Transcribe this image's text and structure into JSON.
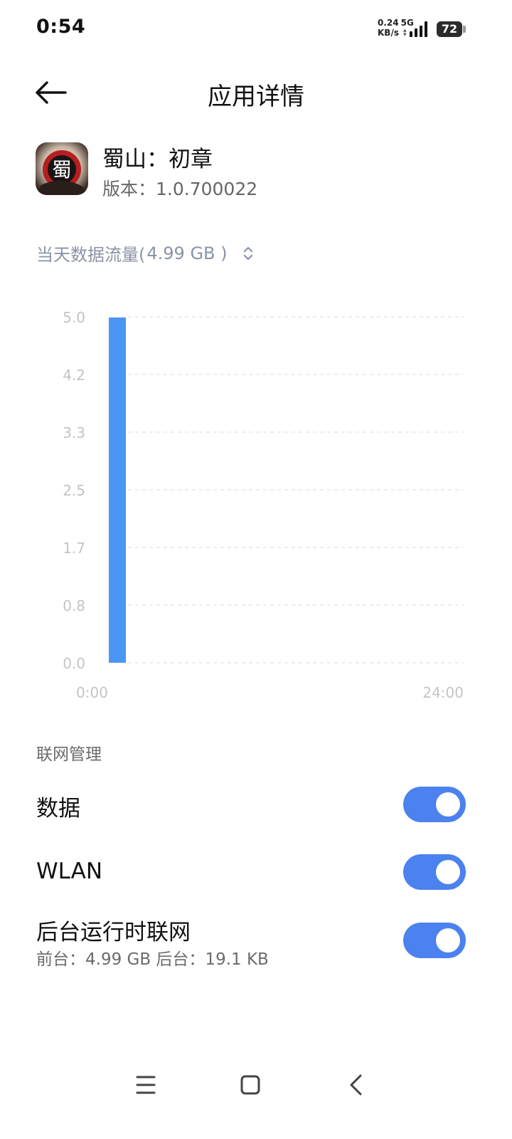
{
  "status_bar": {
    "time": "0:54",
    "net_speed_value": "0.24",
    "net_type": "5G",
    "net_speed_unit": "KB/s",
    "battery": "72",
    "icons": [
      "signal-icon",
      "battery-icon"
    ]
  },
  "header": {
    "title": "应用详情",
    "back_icon": "arrow-left-icon"
  },
  "app": {
    "name": "蜀山：初章",
    "version": "版本：1.0.700022",
    "icon_glyph": "蜀"
  },
  "usage": {
    "label": "当天数据流量(",
    "amount": " 4.99 GB )",
    "selector_icon": "chevron-up-down-icon"
  },
  "chart_data": {
    "type": "bar",
    "y_ticks": [
      "5.0",
      "4.2",
      "3.3",
      "2.5",
      "1.7",
      "0.8",
      "0.0"
    ],
    "ylim": [
      0,
      5.0
    ],
    "x_start_label": "0:00",
    "x_end_label": "24:00",
    "x_domain_hours": [
      0,
      24
    ],
    "bars": [
      {
        "hour": 0,
        "value": 4.99
      }
    ],
    "grid": true,
    "bar_color": "#4a96f3"
  },
  "network": {
    "section_label": "联网管理",
    "rows": [
      {
        "label": "数据",
        "enabled": true
      },
      {
        "label": "WLAN",
        "enabled": true
      },
      {
        "label": "后台运行时联网",
        "sub": "前台：4.99 GB  后台：19.1 KB",
        "enabled": true
      }
    ]
  },
  "nav_bar": {
    "icons": [
      "menu-icon",
      "home-icon",
      "back-icon"
    ]
  },
  "colors": {
    "accent": "#4b82ef",
    "muted_text": "#8a93a6"
  }
}
